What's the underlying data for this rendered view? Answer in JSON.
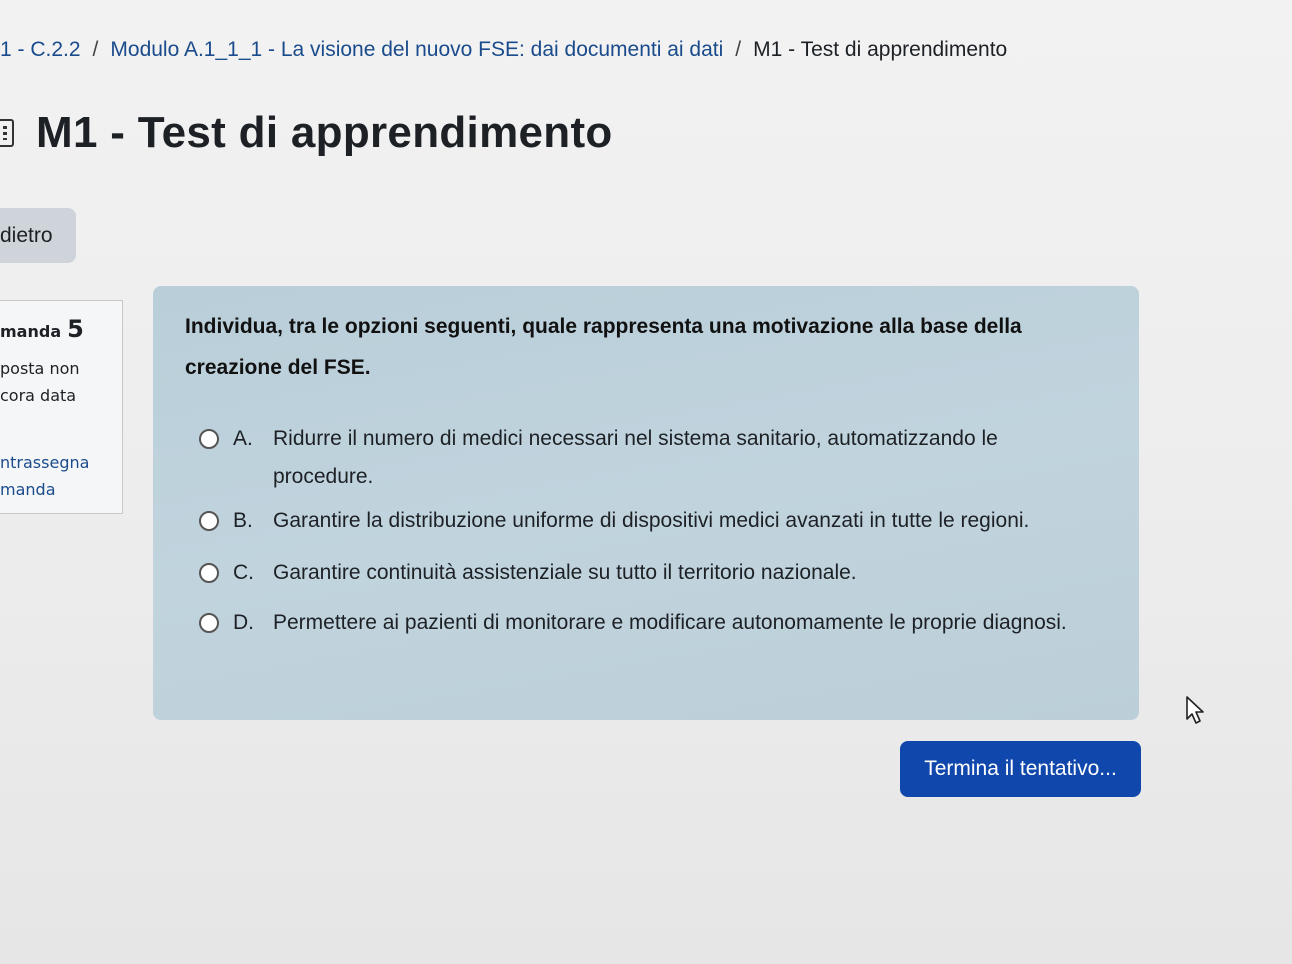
{
  "breadcrumb": {
    "items": [
      "1 - C.2.2",
      "Modulo A.1_1_1 - La visione del nuovo FSE: dai documenti ai dati",
      "M1 - Test di apprendimento"
    ],
    "separator": "/"
  },
  "page": {
    "title": "M1 - Test di apprendimento",
    "back_label": "dietro"
  },
  "question_info": {
    "label": "manda",
    "number": "5",
    "status_line1": "posta non",
    "status_line2": "cora data",
    "flag_line1": "ntrassegna",
    "flag_line2": "manda"
  },
  "question": {
    "text": "Individua, tra le opzioni seguenti, quale rappresenta una motivazione alla base della creazione del FSE.",
    "answers": [
      {
        "letter": "A.",
        "text": "Ridurre il numero di medici necessari nel sistema sanitario, automatizzando le procedure."
      },
      {
        "letter": "B.",
        "text": "Garantire la distribuzione uniforme di dispositivi medici avanzati in tutte le regioni."
      },
      {
        "letter": "C.",
        "text": "Garantire continuità assistenziale su tutto il territorio nazionale."
      },
      {
        "letter": "D.",
        "text": "Permettere ai pazienti di monitorare e modificare autonomamente le proprie diagnosi."
      }
    ]
  },
  "actions": {
    "finish_label": "Termina il tentativo..."
  },
  "colors": {
    "primary_button": "#0f47ad",
    "question_bg": "#bccfd9",
    "link": "#1a4b8c"
  },
  "icons": {
    "quiz": "quiz-icon",
    "cursor": "mouse-pointer-icon"
  }
}
